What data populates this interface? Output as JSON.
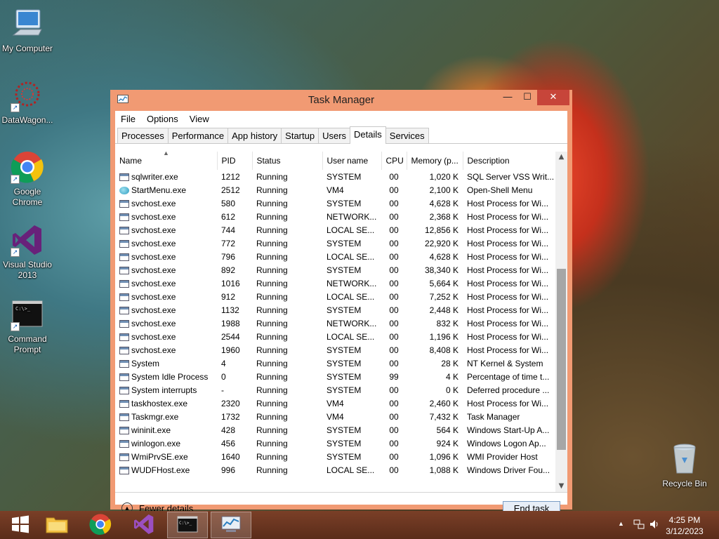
{
  "desktop": {
    "icons": [
      {
        "label": "My Computer"
      },
      {
        "label": "DataWagon..."
      },
      {
        "label": "Google Chrome"
      },
      {
        "label": "Visual Studio 2013"
      },
      {
        "label": "Command Prompt"
      },
      {
        "label": "Recycle Bin"
      }
    ]
  },
  "window": {
    "title": "Task Manager",
    "menu": [
      "File",
      "Options",
      "View"
    ],
    "tabs": [
      "Processes",
      "Performance",
      "App history",
      "Startup",
      "Users",
      "Details",
      "Services"
    ],
    "active_tab": "Details",
    "columns": [
      "Name",
      "PID",
      "Status",
      "User name",
      "CPU",
      "Memory (p...",
      "Description"
    ],
    "rows": [
      {
        "name": "sqlwriter.exe",
        "pid": "1212",
        "status": "Running",
        "user": "SYSTEM",
        "cpu": "00",
        "mem": "1,020 K",
        "desc": "SQL Server VSS Writ..."
      },
      {
        "name": "StartMenu.exe",
        "pid": "2512",
        "status": "Running",
        "user": "VM4",
        "cpu": "00",
        "mem": "2,100 K",
        "desc": "Open-Shell Menu"
      },
      {
        "name": "svchost.exe",
        "pid": "580",
        "status": "Running",
        "user": "SYSTEM",
        "cpu": "00",
        "mem": "4,628 K",
        "desc": "Host Process for Wi..."
      },
      {
        "name": "svchost.exe",
        "pid": "612",
        "status": "Running",
        "user": "NETWORK...",
        "cpu": "00",
        "mem": "2,368 K",
        "desc": "Host Process for Wi..."
      },
      {
        "name": "svchost.exe",
        "pid": "744",
        "status": "Running",
        "user": "LOCAL SE...",
        "cpu": "00",
        "mem": "12,856 K",
        "desc": "Host Process for Wi..."
      },
      {
        "name": "svchost.exe",
        "pid": "772",
        "status": "Running",
        "user": "SYSTEM",
        "cpu": "00",
        "mem": "22,920 K",
        "desc": "Host Process for Wi..."
      },
      {
        "name": "svchost.exe",
        "pid": "796",
        "status": "Running",
        "user": "LOCAL SE...",
        "cpu": "00",
        "mem": "4,628 K",
        "desc": "Host Process for Wi..."
      },
      {
        "name": "svchost.exe",
        "pid": "892",
        "status": "Running",
        "user": "SYSTEM",
        "cpu": "00",
        "mem": "38,340 K",
        "desc": "Host Process for Wi..."
      },
      {
        "name": "svchost.exe",
        "pid": "1016",
        "status": "Running",
        "user": "NETWORK...",
        "cpu": "00",
        "mem": "5,664 K",
        "desc": "Host Process for Wi..."
      },
      {
        "name": "svchost.exe",
        "pid": "912",
        "status": "Running",
        "user": "LOCAL SE...",
        "cpu": "00",
        "mem": "7,252 K",
        "desc": "Host Process for Wi..."
      },
      {
        "name": "svchost.exe",
        "pid": "1132",
        "status": "Running",
        "user": "SYSTEM",
        "cpu": "00",
        "mem": "2,448 K",
        "desc": "Host Process for Wi..."
      },
      {
        "name": "svchost.exe",
        "pid": "1988",
        "status": "Running",
        "user": "NETWORK...",
        "cpu": "00",
        "mem": "832 K",
        "desc": "Host Process for Wi..."
      },
      {
        "name": "svchost.exe",
        "pid": "2544",
        "status": "Running",
        "user": "LOCAL SE...",
        "cpu": "00",
        "mem": "1,196 K",
        "desc": "Host Process for Wi..."
      },
      {
        "name": "svchost.exe",
        "pid": "1960",
        "status": "Running",
        "user": "SYSTEM",
        "cpu": "00",
        "mem": "8,408 K",
        "desc": "Host Process for Wi..."
      },
      {
        "name": "System",
        "pid": "4",
        "status": "Running",
        "user": "SYSTEM",
        "cpu": "00",
        "mem": "28 K",
        "desc": "NT Kernel & System"
      },
      {
        "name": "System Idle Process",
        "pid": "0",
        "status": "Running",
        "user": "SYSTEM",
        "cpu": "99",
        "mem": "4 K",
        "desc": "Percentage of time t..."
      },
      {
        "name": "System interrupts",
        "pid": "-",
        "status": "Running",
        "user": "SYSTEM",
        "cpu": "00",
        "mem": "0 K",
        "desc": "Deferred procedure ..."
      },
      {
        "name": "taskhostex.exe",
        "pid": "2320",
        "status": "Running",
        "user": "VM4",
        "cpu": "00",
        "mem": "2,460 K",
        "desc": "Host Process for Wi..."
      },
      {
        "name": "Taskmgr.exe",
        "pid": "1732",
        "status": "Running",
        "user": "VM4",
        "cpu": "00",
        "mem": "7,432 K",
        "desc": "Task Manager"
      },
      {
        "name": "wininit.exe",
        "pid": "428",
        "status": "Running",
        "user": "SYSTEM",
        "cpu": "00",
        "mem": "564 K",
        "desc": "Windows Start-Up A..."
      },
      {
        "name": "winlogon.exe",
        "pid": "456",
        "status": "Running",
        "user": "SYSTEM",
        "cpu": "00",
        "mem": "924 K",
        "desc": "Windows Logon Ap..."
      },
      {
        "name": "WmiPrvSE.exe",
        "pid": "1640",
        "status": "Running",
        "user": "SYSTEM",
        "cpu": "00",
        "mem": "1,096 K",
        "desc": "WMI Provider Host"
      },
      {
        "name": "WUDFHost.exe",
        "pid": "996",
        "status": "Running",
        "user": "LOCAL SE...",
        "cpu": "00",
        "mem": "1,088 K",
        "desc": "Windows Driver Fou..."
      }
    ],
    "fewer_details": "Fewer details",
    "end_task": "End task"
  },
  "taskbar": {
    "time": "4:25 PM",
    "date": "3/12/2023"
  },
  "colors": {
    "window_frame": "#f19a73",
    "close_button": "#c7453a",
    "taskbar": "#6a3520"
  }
}
